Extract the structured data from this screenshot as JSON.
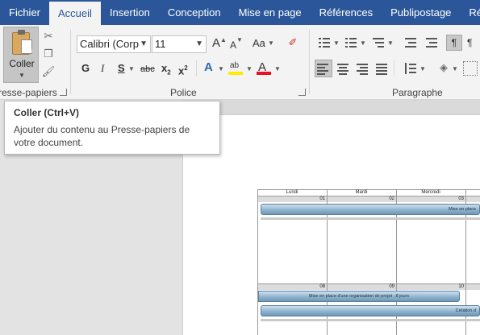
{
  "tabs": [
    "Fichier",
    "Accueil",
    "Insertion",
    "Conception",
    "Mise en page",
    "Références",
    "Publipostage",
    "Révis"
  ],
  "active_tab": "Accueil",
  "ribbon": {
    "clipboard": {
      "paste_label": "Coller",
      "group_label": "resse-papiers"
    },
    "font": {
      "font_name": "Calibri (Corp",
      "font_size": "11",
      "grow": "A",
      "shrink": "A",
      "case_label": "Aa",
      "bold": "G",
      "italic": "I",
      "underline": "S",
      "strike": "abc",
      "subscript": "x",
      "subscript_mark": "2",
      "superscript": "x",
      "superscript_mark": "2",
      "text_effects": "A",
      "highlight": "ab",
      "font_color_glyph": "A",
      "highlight_color": "#ffeb00",
      "font_color": "#e81123",
      "group_label": "Police"
    },
    "paragraph": {
      "group_label": "Paragraphe",
      "show_marks": "¶",
      "rtl_mark": "¶"
    }
  },
  "tooltip": {
    "title": "Coller (Ctrl+V)",
    "body": "Ajouter du contenu au Presse-papiers de votre document."
  },
  "calendar": {
    "day_names": [
      "Lundi",
      "Mardi",
      "Mercredi"
    ],
    "week1_days": [
      "01",
      "02",
      "03"
    ],
    "week2_days": [
      "08",
      "09",
      "10"
    ],
    "bars": {
      "week1_bar": "Mise en place",
      "week2_bar1": "Mise en place d'une organisation de projet ; 8 jours",
      "week2_bar2": "Création d"
    }
  },
  "colors": {
    "tab_bar": "#2b579a",
    "ribbon": "#f3f3f3",
    "accent": "#2b579a"
  }
}
